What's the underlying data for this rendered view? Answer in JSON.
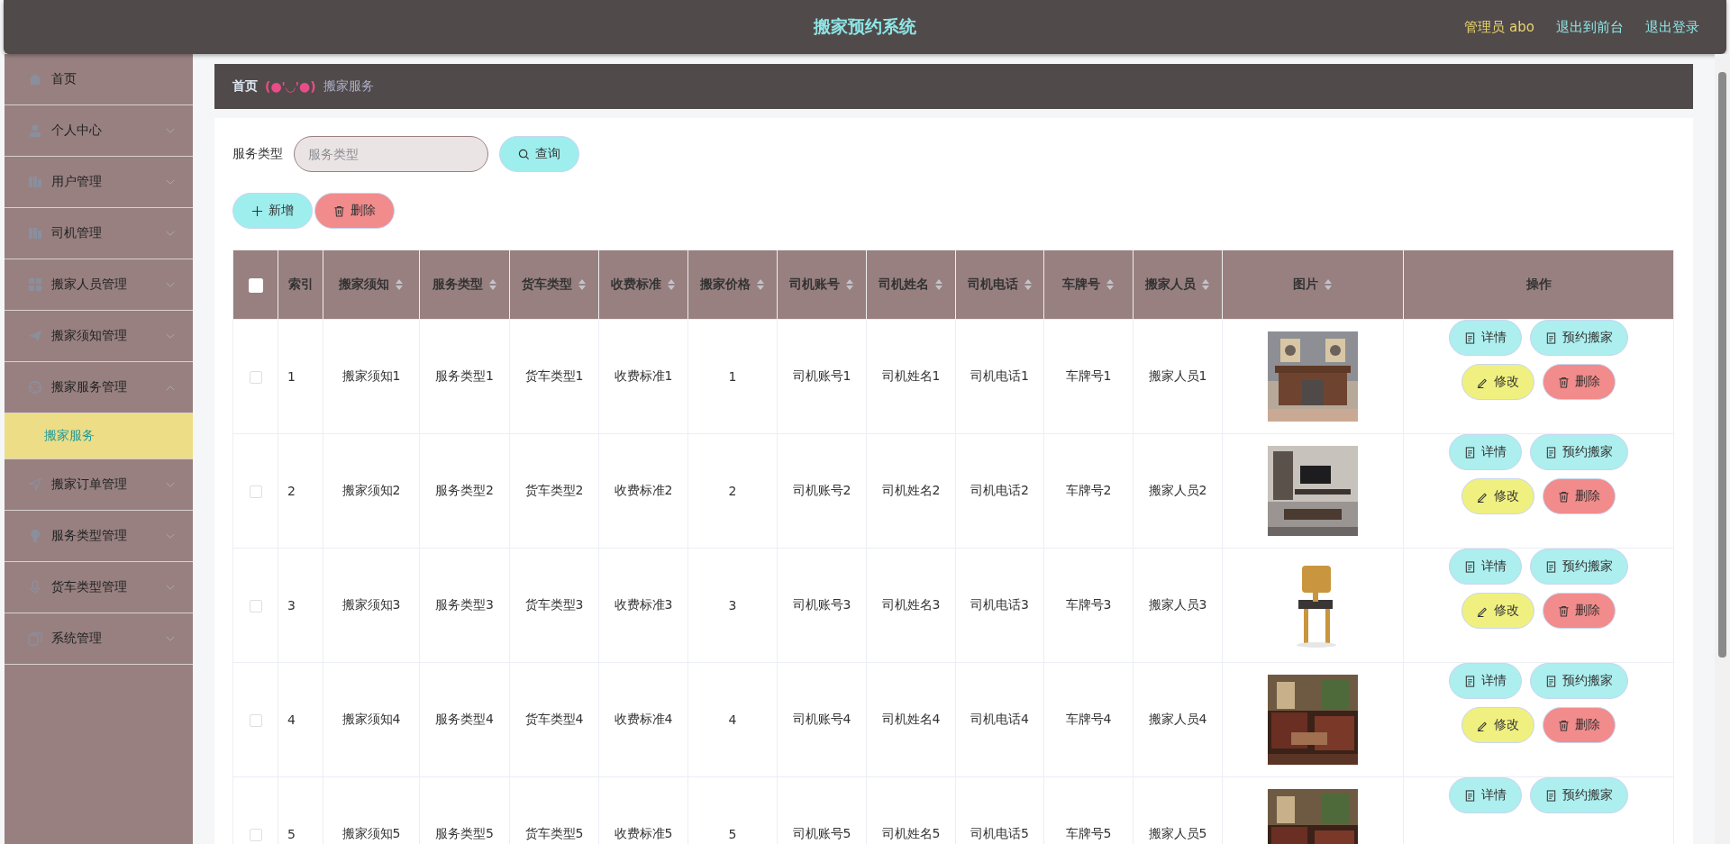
{
  "header": {
    "title": "搬家预约系统",
    "user": "管理员 abo",
    "links": [
      "退出到前台",
      "退出登录"
    ]
  },
  "sidebar": {
    "items": [
      {
        "label": "首页"
      },
      {
        "label": "个人中心",
        "expanded": false
      },
      {
        "label": "用户管理",
        "expanded": false
      },
      {
        "label": "司机管理",
        "expanded": false
      },
      {
        "label": "搬家人员管理",
        "expanded": false
      },
      {
        "label": "搬家须知管理",
        "expanded": false
      },
      {
        "label": "搬家服务管理",
        "expanded": true,
        "children": [
          {
            "label": "搬家服务",
            "selected": true
          }
        ]
      },
      {
        "label": "搬家订单管理",
        "expanded": false
      },
      {
        "label": "服务类型管理",
        "expanded": false
      },
      {
        "label": "货车类型管理",
        "expanded": false
      },
      {
        "label": "系统管理",
        "expanded": false
      }
    ]
  },
  "breadcrumb": {
    "home": "首页",
    "separator": "(●'◡'●)",
    "current": "搬家服务"
  },
  "search": {
    "label": "服务类型",
    "placeholder": "服务类型",
    "button": "查询"
  },
  "actions": [
    {
      "kind": "add",
      "label": "新增"
    },
    {
      "kind": "delete",
      "label": "删除"
    }
  ],
  "table": {
    "columns": [
      {
        "label": "索引",
        "sortable": false
      },
      {
        "label": "搬家须知",
        "sortable": true
      },
      {
        "label": "服务类型",
        "sortable": true
      },
      {
        "label": "货车类型",
        "sortable": true
      },
      {
        "label": "收费标准",
        "sortable": true
      },
      {
        "label": "搬家价格",
        "sortable": true
      },
      {
        "label": "司机账号",
        "sortable": true
      },
      {
        "label": "司机姓名",
        "sortable": true
      },
      {
        "label": "司机电话",
        "sortable": true
      },
      {
        "label": "车牌号",
        "sortable": true
      },
      {
        "label": "搬家人员",
        "sortable": true
      },
      {
        "label": "图片",
        "sortable": true
      },
      {
        "label": "操作",
        "sortable": false
      }
    ],
    "all_checked": false,
    "rows": [
      {
        "checked": false,
        "cells": [
          "1",
          "搬家须知1",
          "服务类型1",
          "货车类型1",
          "收费标准1",
          "1",
          "司机账号1",
          "司机姓名1",
          "司机电话1",
          "车牌号1",
          "搬家人员1"
        ],
        "buttons": [
          {
            "kind": "detail",
            "label": "详情"
          },
          {
            "kind": "book",
            "label": "预约搬家"
          },
          {
            "kind": "edit",
            "label": "修改"
          },
          {
            "kind": "delete",
            "label": "删除"
          }
        ]
      },
      {
        "checked": false,
        "cells": [
          "2",
          "搬家须知2",
          "服务类型2",
          "货车类型2",
          "收费标准2",
          "2",
          "司机账号2",
          "司机姓名2",
          "司机电话2",
          "车牌号2",
          "搬家人员2"
        ],
        "buttons": [
          {
            "kind": "detail",
            "label": "详情"
          },
          {
            "kind": "book",
            "label": "预约搬家"
          },
          {
            "kind": "edit",
            "label": "修改"
          },
          {
            "kind": "delete",
            "label": "删除"
          }
        ]
      },
      {
        "checked": false,
        "cells": [
          "3",
          "搬家须知3",
          "服务类型3",
          "货车类型3",
          "收费标准3",
          "3",
          "司机账号3",
          "司机姓名3",
          "司机电话3",
          "车牌号3",
          "搬家人员3"
        ],
        "buttons": [
          {
            "kind": "detail",
            "label": "详情"
          },
          {
            "kind": "book",
            "label": "预约搬家"
          },
          {
            "kind": "edit",
            "label": "修改"
          },
          {
            "kind": "delete",
            "label": "删除"
          }
        ]
      },
      {
        "checked": false,
        "cells": [
          "4",
          "搬家须知4",
          "服务类型4",
          "货车类型4",
          "收费标准4",
          "4",
          "司机账号4",
          "司机姓名4",
          "司机电话4",
          "车牌号4",
          "搬家人员4"
        ],
        "buttons": [
          {
            "kind": "detail",
            "label": "详情"
          },
          {
            "kind": "book",
            "label": "预约搬家"
          },
          {
            "kind": "edit",
            "label": "修改"
          },
          {
            "kind": "delete",
            "label": "删除"
          }
        ]
      },
      {
        "checked": false,
        "cells": [
          "5",
          "搬家须知5",
          "服务类型5",
          "货车类型5",
          "收费标准5",
          "5",
          "司机账号5",
          "司机姓名5",
          "司机电话5",
          "车牌号5",
          "搬家人员5"
        ],
        "buttons": [
          {
            "kind": "detail",
            "label": "详情"
          },
          {
            "kind": "book",
            "label": "预约搬家"
          }
        ]
      }
    ]
  }
}
